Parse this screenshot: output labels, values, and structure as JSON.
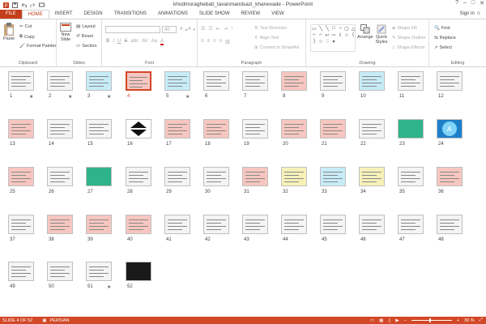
{
  "window": {
    "title": "khodmoraghebati_tavanmandsazi_khanevade - PowerPoint",
    "sign_in": "Sign in",
    "minimize": "–",
    "maximize": "□",
    "close": "✕"
  },
  "tabs": [
    "FILE",
    "HOME",
    "INSERT",
    "DESIGN",
    "TRANSITIONS",
    "ANIMATIONS",
    "SLIDE SHOW",
    "REVIEW",
    "VIEW"
  ],
  "ribbon": {
    "clipboard": {
      "label": "Clipboard",
      "paste": "Paste",
      "cut": "Cut",
      "copy": "Copy",
      "format_painter": "Format Painter"
    },
    "slides": {
      "label": "Slides",
      "new_slide": "New",
      "new_slide2": "Slide",
      "layout": "Layout",
      "reset": "Reset",
      "section": "Section"
    },
    "font": {
      "label": "Font",
      "size": "40",
      "bold": "B",
      "italic": "I",
      "underline": "U",
      "strike": "S",
      "shadow": "abc",
      "spacing": "AV",
      "case": "Aa",
      "color": "A"
    },
    "paragraph": {
      "label": "Paragraph",
      "text_direction": "Text Direction",
      "align_text": "Align Text",
      "smartart": "Convert to SmartArt"
    },
    "drawing": {
      "label": "Drawing",
      "arrange": "Arrange",
      "quick_styles": "Quick Styles",
      "shape_fill": "Shape Fill",
      "shape_outline": "Shape Outline",
      "shape_effects": "Shape Effects"
    },
    "editing": {
      "label": "Editing",
      "find": "Find",
      "replace": "Replace",
      "select": "Select"
    }
  },
  "slides": [
    {
      "n": "1",
      "star": "★"
    },
    {
      "n": "2",
      "star": "★"
    },
    {
      "n": "3",
      "star": "★"
    },
    {
      "n": "4",
      "star": ""
    },
    {
      "n": "5",
      "star": "★"
    },
    {
      "n": "6",
      "star": ""
    },
    {
      "n": "7",
      "star": ""
    },
    {
      "n": "8",
      "star": ""
    },
    {
      "n": "9",
      "star": ""
    },
    {
      "n": "10",
      "star": ""
    },
    {
      "n": "11",
      "star": ""
    },
    {
      "n": "12",
      "star": ""
    },
    {
      "n": "13",
      "star": ""
    },
    {
      "n": "14",
      "star": ""
    },
    {
      "n": "15",
      "star": ""
    },
    {
      "n": "16",
      "star": ""
    },
    {
      "n": "17",
      "star": ""
    },
    {
      "n": "18",
      "star": ""
    },
    {
      "n": "19",
      "star": ""
    },
    {
      "n": "20",
      "star": ""
    },
    {
      "n": "21",
      "star": ""
    },
    {
      "n": "22",
      "star": ""
    },
    {
      "n": "23",
      "star": ""
    },
    {
      "n": "24",
      "star": ""
    },
    {
      "n": "25",
      "star": ""
    },
    {
      "n": "26",
      "star": ""
    },
    {
      "n": "27",
      "star": ""
    },
    {
      "n": "28",
      "star": ""
    },
    {
      "n": "29",
      "star": ""
    },
    {
      "n": "30",
      "star": ""
    },
    {
      "n": "31",
      "star": ""
    },
    {
      "n": "32",
      "star": ""
    },
    {
      "n": "33",
      "star": ""
    },
    {
      "n": "34",
      "star": ""
    },
    {
      "n": "35",
      "star": ""
    },
    {
      "n": "36",
      "star": ""
    },
    {
      "n": "37",
      "star": ""
    },
    {
      "n": "38",
      "star": ""
    },
    {
      "n": "39",
      "star": ""
    },
    {
      "n": "40",
      "star": ""
    },
    {
      "n": "41",
      "star": ""
    },
    {
      "n": "42",
      "star": ""
    },
    {
      "n": "43",
      "star": ""
    },
    {
      "n": "44",
      "star": ""
    },
    {
      "n": "45",
      "star": ""
    },
    {
      "n": "46",
      "star": ""
    },
    {
      "n": "47",
      "star": ""
    },
    {
      "n": "48",
      "star": ""
    },
    {
      "n": "49",
      "star": ""
    },
    {
      "n": "50",
      "star": ""
    },
    {
      "n": "51",
      "star": "★"
    },
    {
      "n": "52",
      "star": ""
    }
  ],
  "selected_slide": "4",
  "thumb_colors": {
    "white": "#f4f4f4",
    "pink": "#f7c6c0",
    "cyan": "#c7ecf7",
    "yellow": "#f6f1b8",
    "green": "#2fb38a",
    "dark": "#1a1a1a",
    "blue": "#1e7fc8",
    "accent": "#d24726"
  },
  "status": {
    "slide": "SLIDE 4 OF 52",
    "language": "PERSIAN",
    "zoom": "30 %"
  }
}
